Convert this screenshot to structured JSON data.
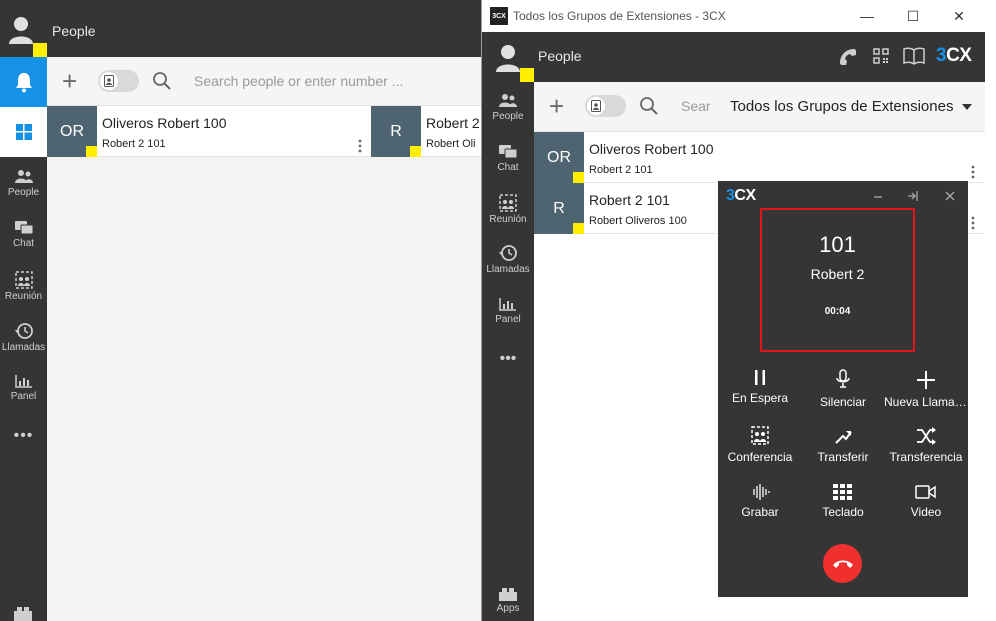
{
  "background_app": {
    "title": "People",
    "search_placeholder": "Search people or enter number ...",
    "nav": [
      {
        "label": "People",
        "icon": "people-icon"
      },
      {
        "label": "Chat",
        "icon": "chat-icon"
      },
      {
        "label": "Reunión",
        "icon": "meeting-icon"
      },
      {
        "label": "Llamadas",
        "icon": "history-icon"
      },
      {
        "label": "Panel",
        "icon": "panel-icon"
      }
    ],
    "more": "•••",
    "contacts": [
      {
        "initials": "OR",
        "name": "Oliveros Robert 100",
        "sub": "Robert 2 101"
      },
      {
        "initials": "R",
        "name": "Robert 2",
        "sub": "Robert Oli"
      }
    ]
  },
  "window": {
    "app_icon_text": "3CX",
    "title": "Todos los Grupos de Extensiones - 3CX",
    "controls": {
      "minimize": "—",
      "maximize": "☐",
      "close": "✕"
    },
    "header_title": "People",
    "brand": {
      "prefix": "3",
      "suffix": "CX"
    },
    "nav": [
      {
        "label": "People",
        "icon": "people-icon"
      },
      {
        "label": "Chat",
        "icon": "chat-icon"
      },
      {
        "label": "Reunión",
        "icon": "meeting-icon"
      },
      {
        "label": "Llamadas",
        "icon": "history-icon"
      },
      {
        "label": "Panel",
        "icon": "panel-icon"
      }
    ],
    "more": "•••",
    "apps_label": "Apps",
    "search_placeholder": "Sear",
    "group_select": "Todos los Grupos de Extensiones",
    "contacts": [
      {
        "initials": "OR",
        "name": "Oliveros Robert 100",
        "sub": "Robert 2 101"
      },
      {
        "initials": "R",
        "name": "Robert 2  101",
        "sub": "Robert Oliveros 100"
      }
    ]
  },
  "call": {
    "logo_prefix": "3",
    "logo_suffix": "CX",
    "number": "101",
    "name": "Robert 2",
    "timer": "00:04",
    "buttons": [
      {
        "label": "En Espera",
        "icon": "pause-icon"
      },
      {
        "label": "Silenciar",
        "icon": "microphone-icon"
      },
      {
        "label": "Nueva Llamada",
        "icon": "plus-icon"
      },
      {
        "label": "Conferencia",
        "icon": "conference-icon"
      },
      {
        "label": "Transferir",
        "icon": "transfer-icon"
      },
      {
        "label": "Transferencia",
        "icon": "shuffle-icon"
      },
      {
        "label": "Grabar",
        "icon": "record-icon"
      },
      {
        "label": "Teclado",
        "icon": "keypad-icon"
      },
      {
        "label": "Video",
        "icon": "video-icon"
      }
    ],
    "colors": {
      "frame": "#e5141a",
      "hangup": "#f0302e",
      "brand_blue": "#1592e6",
      "status": "#ffee00"
    }
  }
}
